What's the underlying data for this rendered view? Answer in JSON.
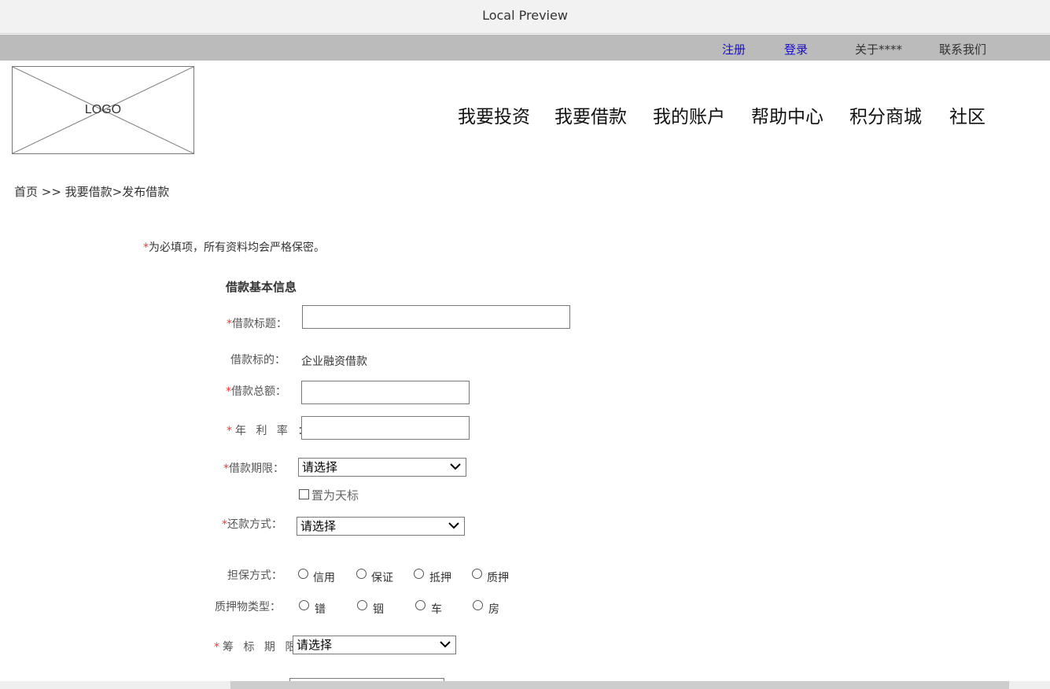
{
  "window": {
    "title": "Local Preview"
  },
  "top_links": {
    "register": "注册",
    "login": "登录",
    "about": "关于****",
    "contact": "联系我们"
  },
  "logo": {
    "label": "LOGO"
  },
  "nav": {
    "invest": "我要投资",
    "borrow": "我要借款",
    "account": "我的账户",
    "help": "帮助中心",
    "mall": "积分商城",
    "community": "社区"
  },
  "breadcrumb": "首页 >> 我要借款>发布借款",
  "required_note": {
    "star": "*",
    "text": "为必填项，所有资料均会严格保密。"
  },
  "form": {
    "section_title": "借款基本信息",
    "loan_title": {
      "label": "借款标题：",
      "value": ""
    },
    "loan_target": {
      "label": "借款标的：",
      "value": "企业融资借款"
    },
    "loan_amount": {
      "label": "借款总额：",
      "value": ""
    },
    "annual_rate": {
      "label": "年 利 率 ：",
      "value": ""
    },
    "loan_term": {
      "label": "借款期限：",
      "selected": "请选择"
    },
    "sky_mark": {
      "label": "置为天标",
      "checked": false
    },
    "repay_method": {
      "label": "还款方式：",
      "selected": "请选择"
    },
    "guarantee": {
      "label": "担保方式：",
      "options": [
        "信用",
        "保证",
        "抵押",
        "质押"
      ]
    },
    "pledge_type": {
      "label": "质押物类型：",
      "options": [
        "镨",
        "铟",
        "车",
        "房"
      ]
    },
    "raise_period": {
      "label": "筹 标 期 限：",
      "selected": "请选择"
    }
  }
}
